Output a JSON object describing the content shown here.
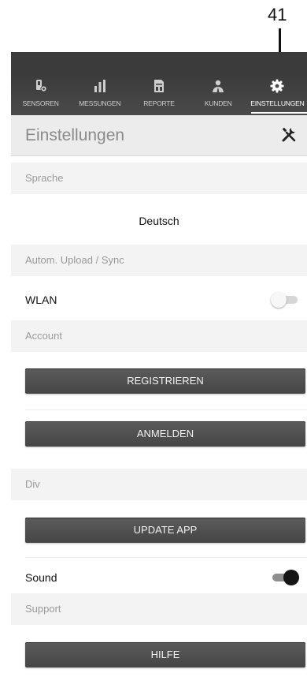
{
  "callout": {
    "number": "41"
  },
  "nav": {
    "tabs": [
      {
        "label": "SENSOREN",
        "icon": "sensor-icon",
        "active": false
      },
      {
        "label": "MESSUNGEN",
        "icon": "bar-chart-icon",
        "active": false
      },
      {
        "label": "REPORTE",
        "icon": "report-icon",
        "active": false
      },
      {
        "label": "KUNDEN",
        "icon": "customers-icon",
        "active": false
      },
      {
        "label": "EINSTELLUNGEN",
        "icon": "gear-icon",
        "active": true
      }
    ]
  },
  "header": {
    "title": "Einstellungen",
    "icon": "tools-icon"
  },
  "sections": {
    "language": {
      "title": "Sprache",
      "value": "Deutsch"
    },
    "upload": {
      "title": "Autom. Upload / Sync",
      "wlan_label": "WLAN",
      "wlan_on": false
    },
    "account": {
      "title": "Account",
      "register_label": "REGISTRIEREN",
      "login_label": "ANMELDEN"
    },
    "div": {
      "title": "Div",
      "update_label": "UPDATE APP",
      "sound_label": "Sound",
      "sound_on": true
    },
    "support": {
      "title": "Support",
      "help_label": "HILFE"
    }
  }
}
